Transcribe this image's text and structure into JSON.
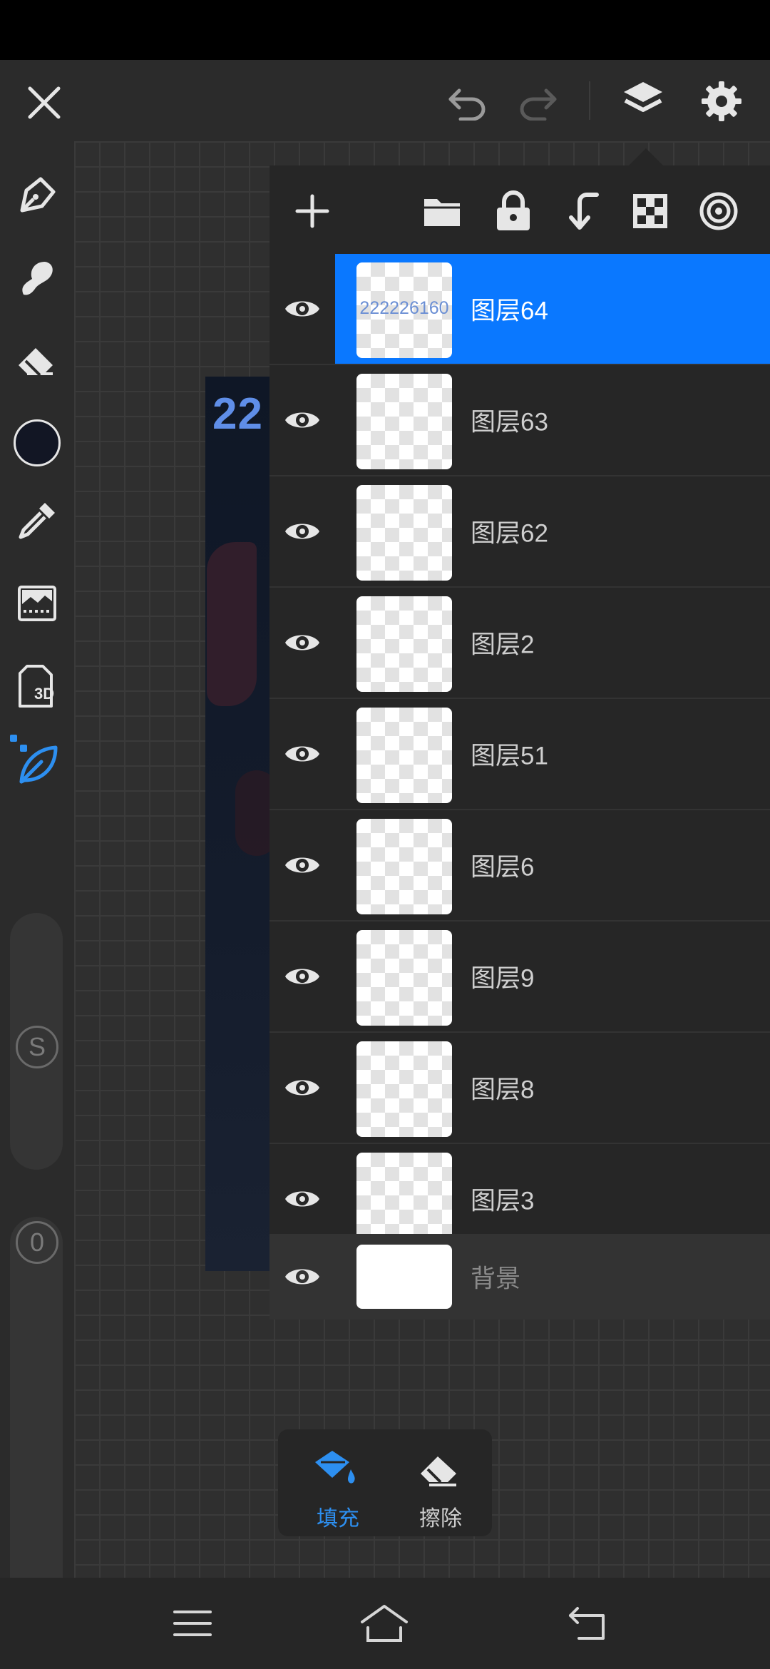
{
  "colors": {
    "accent": "#0a78ff",
    "background": "#2b2b2b",
    "panel": "#262626",
    "icon": "#e6e6e6",
    "brush_active": "#2d8ff0",
    "current_color": "#121624"
  },
  "topbar": {
    "close_icon": "close-icon",
    "undo_icon": "undo-icon",
    "redo_icon": "redo-icon",
    "layers_icon": "layers-icon",
    "settings_icon": "gear-icon"
  },
  "toolbar": {
    "tools": [
      "pen-icon",
      "smudge-icon",
      "eraser-icon",
      "color-swatch",
      "eyedropper-icon",
      "adjust-icon",
      "3d-file-icon",
      "brush-leaf-icon"
    ],
    "three_d_label": "3D",
    "size_slider_label": "S",
    "opacity_slider_label": "0"
  },
  "canvas": {
    "art_text": "22"
  },
  "layers_panel": {
    "actions": [
      "add-layer-icon",
      "folder-icon",
      "lock-icon",
      "merge-down-icon",
      "transparency-icon",
      "clipping-icon"
    ],
    "layers": [
      {
        "name": "图层64",
        "thumb_text": "222226160",
        "selected": true
      },
      {
        "name": "图层63",
        "thumb_text": "",
        "selected": false
      },
      {
        "name": "图层62",
        "thumb_text": "",
        "selected": false
      },
      {
        "name": "图层2",
        "thumb_text": "",
        "selected": false
      },
      {
        "name": "图层51",
        "thumb_text": "",
        "selected": false
      },
      {
        "name": "图层6",
        "thumb_text": "",
        "selected": false
      },
      {
        "name": "图层9",
        "thumb_text": "",
        "selected": false
      },
      {
        "name": "图层8",
        "thumb_text": "",
        "selected": false
      },
      {
        "name": "图层3",
        "thumb_text": "",
        "selected": false
      }
    ],
    "background_layer": "背景"
  },
  "tool_popup": {
    "fill_label": "填充",
    "erase_label": "擦除"
  },
  "navbar": {
    "menu_icon": "menu-icon",
    "home_icon": "home-icon",
    "back_icon": "back-icon"
  }
}
